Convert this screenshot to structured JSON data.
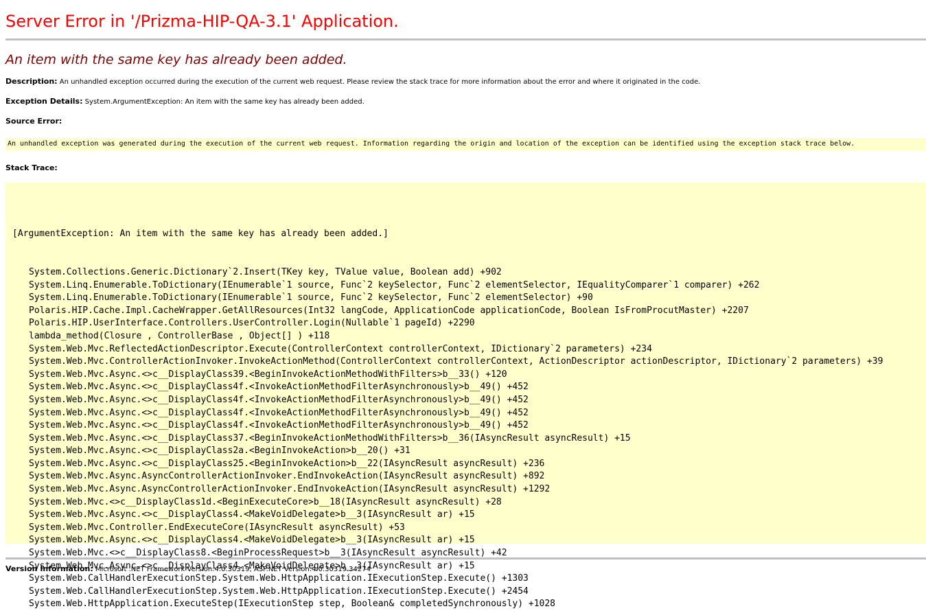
{
  "title": "Server Error in '/Prizma-HIP-QA-3.1' Application.",
  "message": "An item with the same key has already been added.",
  "description": {
    "label": "Description:",
    "text": "An unhandled exception occurred during the execution of the current web request. Please review the stack trace for more information about the error and where it originated in the code."
  },
  "exception_details": {
    "label": "Exception Details:",
    "text": "System.ArgumentException: An item with the same key has already been added."
  },
  "source_error": {
    "label": "Source Error:",
    "text": "An unhandled exception was generated during the execution of the current web request. Information regarding the origin and location of the exception can be identified using the exception stack trace below."
  },
  "stack_trace": {
    "label": "Stack Trace:",
    "header": "[ArgumentException: An item with the same key has already been added.]",
    "lines": [
      "System.Collections.Generic.Dictionary`2.Insert(TKey key, TValue value, Boolean add) +902",
      "System.Linq.Enumerable.ToDictionary(IEnumerable`1 source, Func`2 keySelector, Func`2 elementSelector, IEqualityComparer`1 comparer) +262",
      "System.Linq.Enumerable.ToDictionary(IEnumerable`1 source, Func`2 keySelector, Func`2 elementSelector) +90",
      "Polaris.HIP.Cache.Impl.CacheWrapper.GetAllResources(Int32 langCode, ApplicationCode applicationCode, Boolean IsFromProcutMaster) +2207",
      "Polaris.HIP.UserInterface.Controllers.UserController.Login(Nullable`1 pageId) +2290",
      "lambda_method(Closure , ControllerBase , Object[] ) +118",
      "System.Web.Mvc.ReflectedActionDescriptor.Execute(ControllerContext controllerContext, IDictionary`2 parameters) +234",
      "System.Web.Mvc.ControllerActionInvoker.InvokeActionMethod(ControllerContext controllerContext, ActionDescriptor actionDescriptor, IDictionary`2 parameters) +39",
      "System.Web.Mvc.Async.<>c__DisplayClass39.<BeginInvokeActionMethodWithFilters>b__33() +120",
      "System.Web.Mvc.Async.<>c__DisplayClass4f.<InvokeActionMethodFilterAsynchronously>b__49() +452",
      "System.Web.Mvc.Async.<>c__DisplayClass4f.<InvokeActionMethodFilterAsynchronously>b__49() +452",
      "System.Web.Mvc.Async.<>c__DisplayClass4f.<InvokeActionMethodFilterAsynchronously>b__49() +452",
      "System.Web.Mvc.Async.<>c__DisplayClass4f.<InvokeActionMethodFilterAsynchronously>b__49() +452",
      "System.Web.Mvc.Async.<>c__DisplayClass37.<BeginInvokeActionMethodWithFilters>b__36(IAsyncResult asyncResult) +15",
      "System.Web.Mvc.Async.<>c__DisplayClass2a.<BeginInvokeAction>b__20() +31",
      "System.Web.Mvc.Async.<>c__DisplayClass25.<BeginInvokeAction>b__22(IAsyncResult asyncResult) +236",
      "System.Web.Mvc.Async.AsyncControllerActionInvoker.EndInvokeAction(IAsyncResult asyncResult) +892",
      "System.Web.Mvc.Async.AsyncControllerActionInvoker.EndInvokeAction(IAsyncResult asyncResult) +1292",
      "System.Web.Mvc.<>c__DisplayClass1d.<BeginExecuteCore>b__18(IAsyncResult asyncResult) +28",
      "System.Web.Mvc.Async.<>c__DisplayClass4.<MakeVoidDelegate>b__3(IAsyncResult ar) +15",
      "System.Web.Mvc.Controller.EndExecuteCore(IAsyncResult asyncResult) +53",
      "System.Web.Mvc.Async.<>c__DisplayClass4.<MakeVoidDelegate>b__3(IAsyncResult ar) +15",
      "System.Web.Mvc.<>c__DisplayClass8.<BeginProcessRequest>b__3(IAsyncResult asyncResult) +42",
      "System.Web.Mvc.Async.<>c__DisplayClass4.<MakeVoidDelegate>b__3(IAsyncResult ar) +15",
      "System.Web.CallHandlerExecutionStep.System.Web.HttpApplication.IExecutionStep.Execute() +1303",
      "System.Web.CallHandlerExecutionStep.System.Web.HttpApplication.IExecutionStep.Execute() +2454",
      "System.Web.HttpApplication.ExecuteStep(IExecutionStep step, Boolean& completedSynchronously) +1028"
    ]
  },
  "version_info": {
    "label": "Version Information:",
    "text": "Microsoft .NET Framework Version:4.0.30319; ASP.NET Version:4.0.30319.34274"
  },
  "colors": {
    "title": "#ff0000",
    "message": "#800000",
    "code_background": "#ffffcc",
    "rule": "#c0c0c0"
  }
}
